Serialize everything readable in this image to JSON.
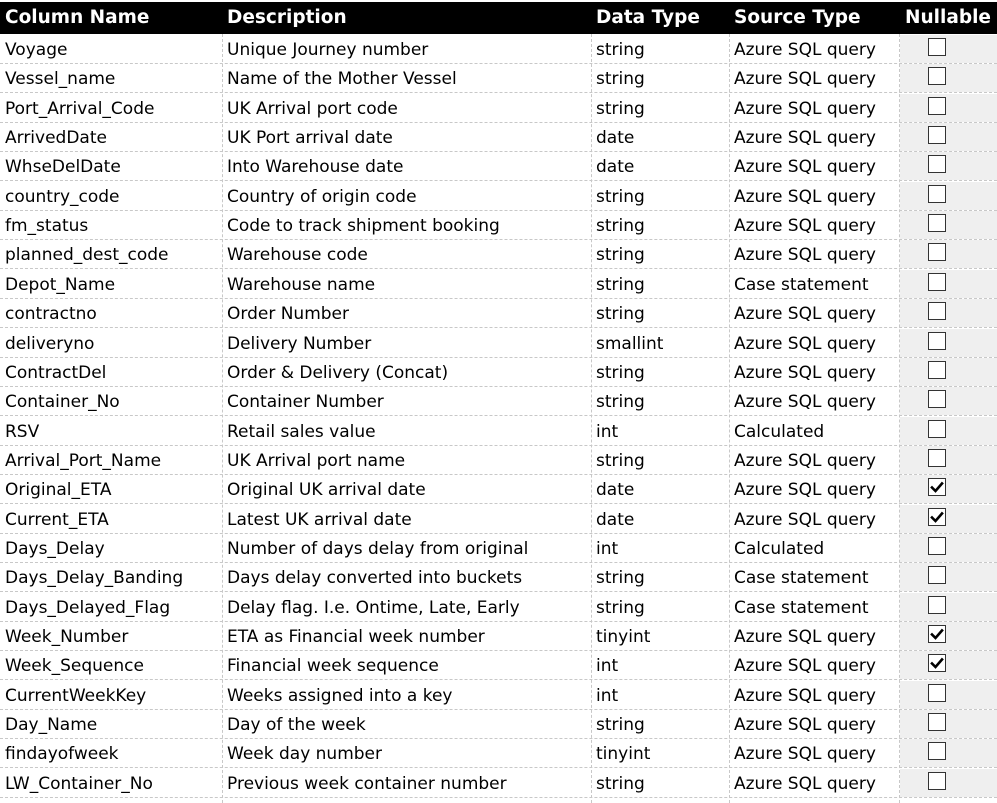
{
  "table": {
    "headers": [
      "Column Name",
      "Description",
      "Data Type",
      "Source Type",
      "Nullable"
    ],
    "rows": [
      {
        "name": "Voyage",
        "description": "Unique Journey number",
        "type": "string",
        "source": "Azure SQL query",
        "nullable": false
      },
      {
        "name": "Vessel_name",
        "description": "Name of the Mother Vessel",
        "type": "string",
        "source": "Azure SQL query",
        "nullable": false
      },
      {
        "name": "Port_Arrival_Code",
        "description": "UK Arrival port code",
        "type": "string",
        "source": "Azure SQL query",
        "nullable": false
      },
      {
        "name": "ArrivedDate",
        "description": "UK Port arrival date",
        "type": "date",
        "source": "Azure SQL query",
        "nullable": false
      },
      {
        "name": "WhseDelDate",
        "description": "Into Warehouse date",
        "type": "date",
        "source": "Azure SQL query",
        "nullable": false
      },
      {
        "name": "country_code",
        "description": "Country of origin code",
        "type": "string",
        "source": "Azure SQL query",
        "nullable": false
      },
      {
        "name": "fm_status",
        "description": "Code to track shipment booking",
        "type": "string",
        "source": "Azure SQL query",
        "nullable": false
      },
      {
        "name": "planned_dest_code",
        "description": "Warehouse code",
        "type": "string",
        "source": "Azure SQL query",
        "nullable": false
      },
      {
        "name": "Depot_Name",
        "description": "Warehouse name",
        "type": "string",
        "source": "Case statement",
        "nullable": false
      },
      {
        "name": "contractno",
        "description": "Order Number",
        "type": "string",
        "source": "Azure SQL query",
        "nullable": false
      },
      {
        "name": "deliveryno",
        "description": "Delivery Number",
        "type": "smallint",
        "source": "Azure SQL query",
        "nullable": false
      },
      {
        "name": "ContractDel",
        "description": "Order & Delivery (Concat)",
        "type": "string",
        "source": "Azure SQL query",
        "nullable": false
      },
      {
        "name": "Container_No",
        "description": "Container Number",
        "type": "string",
        "source": "Azure SQL query",
        "nullable": false
      },
      {
        "name": "RSV",
        "description": "Retail sales value",
        "type": "int",
        "source": "Calculated",
        "nullable": false
      },
      {
        "name": "Arrival_Port_Name",
        "description": "UK Arrival port name",
        "type": "string",
        "source": "Azure SQL query",
        "nullable": false
      },
      {
        "name": "Original_ETA",
        "description": "Original UK arrival date",
        "type": "date",
        "source": "Azure SQL query",
        "nullable": true
      },
      {
        "name": "Current_ETA",
        "description": "Latest UK arrival date",
        "type": "date",
        "source": "Azure SQL query",
        "nullable": true
      },
      {
        "name": "Days_Delay",
        "description": "Number of days delay from original",
        "type": "int",
        "source": "Calculated",
        "nullable": false
      },
      {
        "name": "Days_Delay_Banding",
        "description": "Days delay converted into buckets",
        "type": "string",
        "source": "Case statement",
        "nullable": false
      },
      {
        "name": "Days_Delayed_Flag",
        "description": "Delay flag. I.e. Ontime, Late, Early",
        "type": "string",
        "source": "Case statement",
        "nullable": false
      },
      {
        "name": "Week_Number",
        "description": "ETA as Financial week number",
        "type": "tinyint",
        "source": "Azure SQL query",
        "nullable": true
      },
      {
        "name": "Week_Sequence",
        "description": "Financial week sequence",
        "type": "int",
        "source": "Azure SQL query",
        "nullable": true
      },
      {
        "name": "CurrentWeekKey",
        "description": "Weeks assigned into a key",
        "type": "int",
        "source": "Azure SQL query",
        "nullable": false
      },
      {
        "name": "Day_Name",
        "description": "Day of the week",
        "type": "string",
        "source": "Azure SQL query",
        "nullable": false
      },
      {
        "name": "findayofweek",
        "description": "Week day number",
        "type": "tinyint",
        "source": "Azure SQL query",
        "nullable": false
      },
      {
        "name": "LW_Container_No",
        "description": "Previous week container number",
        "type": "string",
        "source": "Azure SQL query",
        "nullable": false
      }
    ]
  }
}
